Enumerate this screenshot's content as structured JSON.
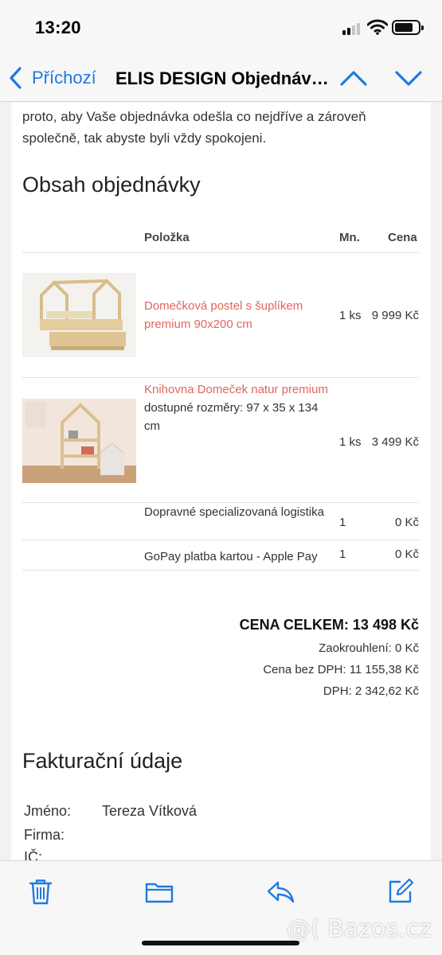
{
  "status_bar": {
    "time": "13:20"
  },
  "nav": {
    "back_label": "Příchozí",
    "title": "ELIS DESIGN Objednávka"
  },
  "email": {
    "intro_text": "proto, aby Vaše objednávka odešla co nejdříve a zároveň společně, tak abyste byli vždy spokojeni.",
    "order_heading": "Obsah objednávky",
    "table_headers": {
      "item": "Položka",
      "qty": "Mn.",
      "price": "Cena"
    },
    "items": [
      {
        "name": "Domečková postel s šuplíkem premium 90x200 cm",
        "detail": "",
        "qty": "1 ks",
        "price": "9 999 Kč"
      },
      {
        "name": "Knihovna Domeček natur premium",
        "detail": "dostupné rozměry: 97 x 35 x 134 cm",
        "qty": "1 ks",
        "price": "3 499 Kč"
      }
    ],
    "extras": [
      {
        "name": "Dopravné specializovaná logistika",
        "qty": "1",
        "price": "0 Kč"
      },
      {
        "name": "GoPay platba kartou - Apple Pay",
        "qty": "1",
        "price": "0 Kč"
      }
    ],
    "totals": {
      "total": "CENA CELKEM: 13 498 Kč",
      "rounding": "Zaokrouhlení: 0 Kč",
      "without_vat": "Cena bez DPH: 11 155,38 Kč",
      "vat": "DPH: 2 342,62 Kč"
    },
    "billing_heading": "Fakturační údaje",
    "billing": {
      "name_label": "Jméno:",
      "name_value": "Tereza Vítková",
      "company_label": "Firma:",
      "ico_label": "IČ:"
    }
  },
  "toolbar": {
    "icons": [
      "trash-icon",
      "folder-icon",
      "reply-icon",
      "compose-icon"
    ]
  },
  "watermark": "@( Bazos.cz",
  "colors": {
    "accent": "#1f7ae0",
    "link": "#e0665f"
  }
}
